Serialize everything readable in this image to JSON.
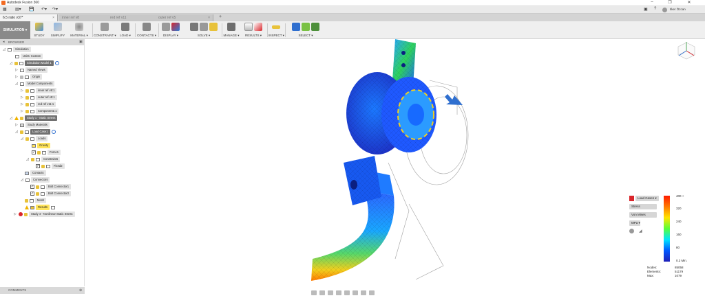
{
  "app": {
    "title": "Autodesk Fusion 360"
  },
  "user": {
    "name": "Ilker Özcan"
  },
  "tabs": [
    {
      "label": "6.5 ratio v37*",
      "active": true
    },
    {
      "label": "inner ref v8",
      "active": false
    },
    {
      "label": "red ref v11",
      "active": false
    },
    {
      "label": "outer ref v5",
      "active": false
    }
  ],
  "ribbon": {
    "workspace": "SIMULATION ▾",
    "groups": [
      {
        "label": "STUDY"
      },
      {
        "label": "SIMPLIFY"
      },
      {
        "label": "MATERIAL ▾"
      },
      {
        "label": "CONSTRAINT ▾"
      },
      {
        "label": "LOAD ▾"
      },
      {
        "label": "CONTACTS ▾"
      },
      {
        "label": "DISPLAY ▾"
      },
      {
        "label": "SOLVE ▾"
      },
      {
        "label": "MANAGE ▾"
      },
      {
        "label": "RESULTS ▾"
      },
      {
        "label": "INSPECT ▾"
      },
      {
        "label": "SELECT ▾"
      }
    ]
  },
  "browser": {
    "header": "BROWSER",
    "items": [
      {
        "label": "Simulation"
      },
      {
        "label": "Units: Custom"
      },
      {
        "label": "Simulation Model 1"
      },
      {
        "label": "Named Views"
      },
      {
        "label": "Origin"
      },
      {
        "label": "Model Components"
      },
      {
        "label": "inner ref v8:1"
      },
      {
        "label": "outer ref v5:1"
      },
      {
        "label": "red ref v11:1"
      },
      {
        "label": "Component1:1"
      },
      {
        "label": "Study 1 - Static Stress"
      },
      {
        "label": "Study Materials"
      },
      {
        "label": "Load Case1"
      },
      {
        "label": "Loads"
      },
      {
        "label": "Gravity"
      },
      {
        "label": "Force1"
      },
      {
        "label": "Constraints"
      },
      {
        "label": "Fixed2"
      },
      {
        "label": "Contacts"
      },
      {
        "label": "Connectors"
      },
      {
        "label": "Bolt Connector1"
      },
      {
        "label": "Bolt Connector2"
      },
      {
        "label": "Mesh"
      },
      {
        "label": "Results"
      },
      {
        "label": "Study 4 - Nonlinear Static Stress"
      }
    ]
  },
  "comments": {
    "label": "COMMENTS"
  },
  "legend": {
    "load_case": "Load Case1 ▾",
    "result_type": "Stress",
    "component": "Von Mises",
    "unit": "MPa ▾",
    "ticks": [
      "400 +",
      "320",
      "240",
      "160",
      "80",
      "0.2 Min."
    ],
    "stats": [
      {
        "label": "Nodes:",
        "value": "85058"
      },
      {
        "label": "Elements:",
        "value": "51179"
      },
      {
        "label": "Max:",
        "value": "1079"
      }
    ]
  },
  "colors": {
    "accent": "#2f6fcf",
    "ribbon_bg": "#efefef",
    "workspace_bg": "#8a8a8a"
  }
}
